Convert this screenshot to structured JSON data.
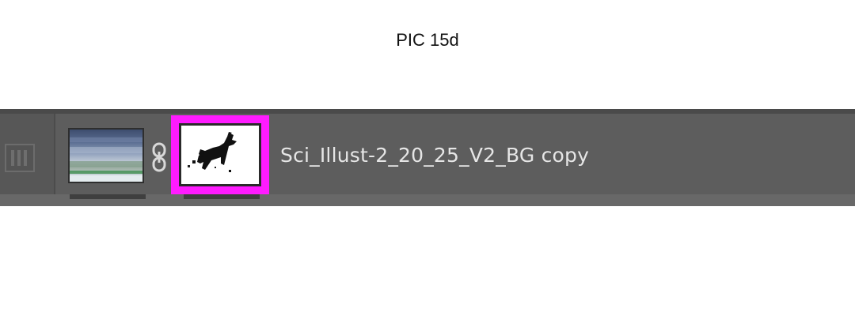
{
  "caption": "PIC 15d",
  "layer": {
    "name": "Sci_Illust-2_20_25_V2_BG copy",
    "thumbnail_icon": "landscape-thumbnail-icon",
    "link_icon": "chain-link-icon",
    "mask_icon": "horse-mask-thumbnail-icon",
    "highlight_color": "#ff1bff"
  },
  "panel": {
    "background_color": "#5d5d5d"
  }
}
